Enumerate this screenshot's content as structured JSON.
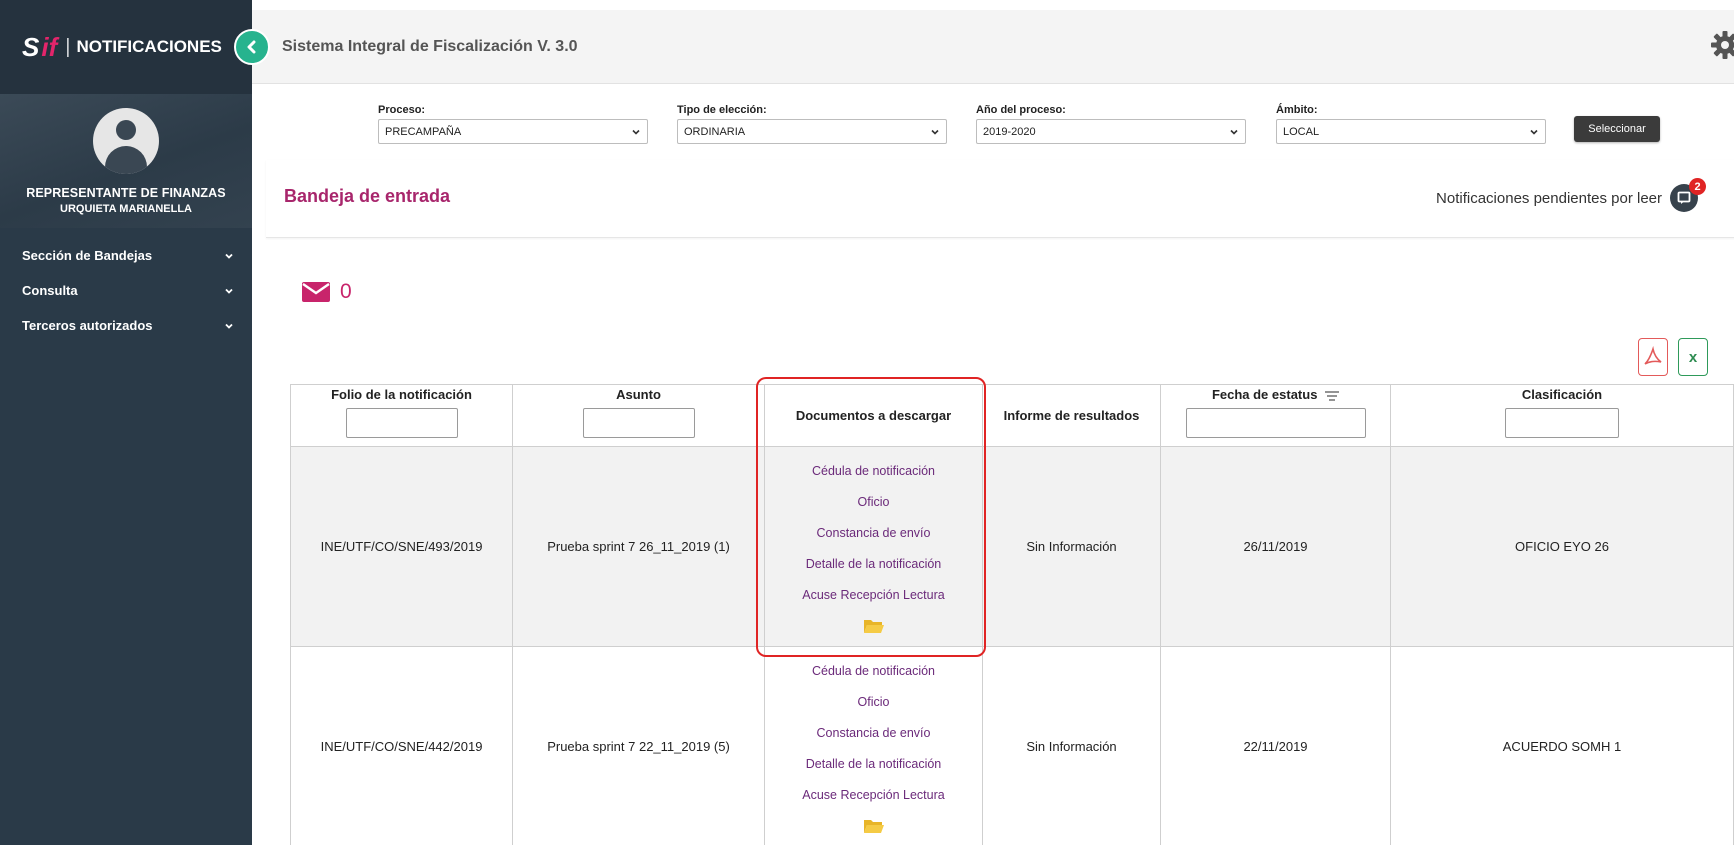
{
  "brand": {
    "logo_s": "S",
    "logo_if": "if",
    "separator": "|",
    "title": "NOTIFICACIONES"
  },
  "profile": {
    "role": "REPRESENTANTE DE FINANZAS",
    "name": "URQUIETA MARIANELLA"
  },
  "menu": [
    {
      "label": "Sección de Bandejas"
    },
    {
      "label": "Consulta"
    },
    {
      "label": "Terceros autorizados"
    }
  ],
  "header": {
    "title": "Sistema Integral de Fiscalización V. 3.0"
  },
  "filters": {
    "proceso": {
      "label": "Proceso:",
      "value": "PRECAMPAÑA"
    },
    "tipo": {
      "label": "Tipo de elección:",
      "value": "ORDINARIA"
    },
    "anio": {
      "label": "Año del proceso:",
      "value": "2019-2020"
    },
    "ambito": {
      "label": "Ámbito:",
      "value": "LOCAL"
    },
    "button": "Seleccionar"
  },
  "inbox": {
    "title": "Bandeja de entrada",
    "pending_label": "Notificaciones pendientes por leer",
    "pending_count": "2",
    "mail_count": "0"
  },
  "export": {
    "excel_label": "x"
  },
  "table": {
    "columns": {
      "folio": "Folio de la notificación",
      "asunto": "Asunto",
      "documentos": "Documentos a descargar",
      "informe": "Informe de resultados",
      "fecha": "Fecha de estatus",
      "clasificacion": "Clasificación"
    },
    "doc_links": [
      "Cédula de notificación",
      "Oficio",
      "Constancia de envío",
      "Detalle de la notificación",
      "Acuse Recepción Lectura"
    ],
    "rows": [
      {
        "folio": "INE/UTF/CO/SNE/493/2019",
        "asunto": "Prueba sprint 7 26_11_2019 (1)",
        "informe": "Sin Información",
        "fecha": "26/11/2019",
        "clasificacion": "OFICIO EYO 26"
      },
      {
        "folio": "INE/UTF/CO/SNE/442/2019",
        "asunto": "Prueba sprint 7 22_11_2019 (5)",
        "informe": "Sin Información",
        "fecha": "22/11/2019",
        "clasificacion": "ACUERDO SOMH 1"
      }
    ]
  },
  "colors": {
    "sidebar": "#2a3a48",
    "accent": "#a8266c",
    "toggle": "#27b38e",
    "badge": "#e02424",
    "link": "#6b2a7a",
    "highlight": "#e02424"
  }
}
